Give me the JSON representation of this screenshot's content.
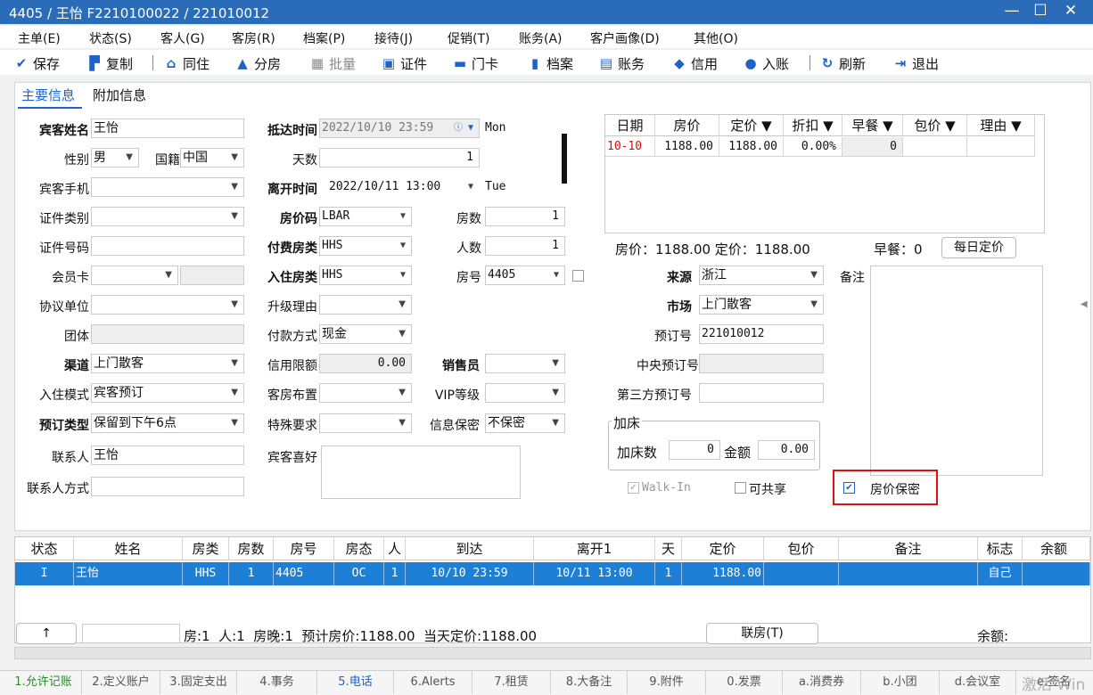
{
  "window": {
    "title": "4405 / 王怡 F2210100022 / 221010012",
    "min_glyph": "—",
    "max_glyph": "☐",
    "close_glyph": "✕"
  },
  "menu": [
    "主单(E)",
    "状态(S)",
    "客人(G)",
    "客房(R)",
    "档案(P)",
    "接待(J)",
    "促销(T)",
    "账务(A)",
    "客户画像(D)",
    "其他(O)"
  ],
  "toolbar": {
    "save": "保存",
    "copy": "复制",
    "cohabit": "同住",
    "split": "分房",
    "batch": "批量",
    "id": "证件",
    "card": "门卡",
    "archive": "档案",
    "account": "账务",
    "credit": "信用",
    "post": "入账",
    "refresh": "刷新",
    "exit": "退出"
  },
  "tabs": {
    "main": "主要信息",
    "extra": "附加信息"
  },
  "col1": {
    "guest_name_label": "宾客姓名",
    "guest_name": "王怡",
    "gender_label": "性别",
    "gender": "男",
    "nationality_label": "国籍",
    "nationality": "中国",
    "mobile_label": "宾客手机",
    "id_type_label": "证件类别",
    "id_no_label": "证件号码",
    "member_label": "会员卡",
    "company_label": "协议单位",
    "group_label": "团体",
    "channel_label": "渠道",
    "channel": "上门散客",
    "checkin_mode_label": "入住模式",
    "checkin_mode": "宾客预订",
    "booking_type_label": "预订类型",
    "booking_type": "保留到下午6点",
    "contact_label": "联系人",
    "contact": "王怡",
    "contact_method_label": "联系人方式"
  },
  "col2": {
    "arrive_label": "抵达时间",
    "arrive": "2022/10/10 23:59",
    "arrive_dow": "Mon",
    "days_label": "天数",
    "days": "1",
    "depart_label": "离开时间",
    "depart": "2022/10/11 13:00",
    "depart_dow": "Tue",
    "rate_code_label": "房价码",
    "rate_code": "LBAR",
    "rooms_label": "房数",
    "rooms": "1",
    "pay_type_label": "付费房类",
    "pay_type": "HHS",
    "persons_label": "人数",
    "persons": "1",
    "room_type_label": "入住房类",
    "room_type": "HHS",
    "room_no_label": "房号",
    "room_no": "4405",
    "upgrade_label": "升级理由",
    "pay_method_label": "付款方式",
    "pay_method": "现金",
    "credit_label": "信用限额",
    "credit": "0.00",
    "sales_label": "销售员",
    "layout_label": "客房布置",
    "vip_label": "VIP等级",
    "special_label": "特殊要求",
    "privacy_label": "信息保密",
    "privacy": "不保密",
    "prefs_label": "宾客喜好"
  },
  "rate_grid": {
    "headers": [
      "日期",
      "房价",
      "定价 ▼",
      "折扣 ▼",
      "早餐 ▼",
      "包价 ▼",
      "理由 ▼"
    ],
    "row": [
      "10-10",
      "1188.00",
      "1188.00",
      "0.00%",
      "0",
      "",
      ""
    ],
    "summary": "房价：1188.00 定价：1188.00",
    "breakfast": "早餐：0",
    "daily_btn": "每日定价"
  },
  "col3": {
    "source_label": "来源",
    "source": "浙江",
    "market_label": "市场",
    "market": "上门散客",
    "resv_no_label": "预订号",
    "resv_no": "221010012",
    "central_label": "中央预订号",
    "third_label": "第三方预订号",
    "note_label": "备注",
    "extra_bed_group": "加床",
    "extra_bed_count_label": "加床数",
    "extra_bed_count": "0",
    "amount_label": "金额",
    "amount": "0.00",
    "walkin": "Walk-In",
    "shareable": "可共享",
    "rate_secret": "房价保密"
  },
  "bottom_grid": {
    "headers": [
      "状态",
      "姓名",
      "房类",
      "房数",
      "房号",
      "房态",
      "人",
      "到达",
      "离开1",
      "天",
      "定价",
      "包价",
      "备注",
      "标志",
      "余额"
    ],
    "row": [
      "I",
      "王怡",
      "HHS",
      "1",
      "4405",
      "OC",
      "1",
      "10/10 23:59",
      "10/11 13:00",
      "1",
      "1188.00",
      "",
      "",
      "自己",
      ""
    ]
  },
  "footer": {
    "up": "↑",
    "summary": "房:1  人:1  房晚:1  预计房价:1188.00  当天定价:1188.00",
    "link_btn": "联房(T)",
    "balance": "余额:"
  },
  "status_tabs": [
    "1.允许记账",
    "2.定义账户",
    "3.固定支出",
    "4.事务",
    "5.电话",
    "6.Alerts",
    "7.租赁",
    "8.大备注",
    "9.附件",
    "0.发票",
    "a.消费券",
    "b.小团",
    "d.会议室",
    "e.签名"
  ],
  "watermark": "激活 Win"
}
